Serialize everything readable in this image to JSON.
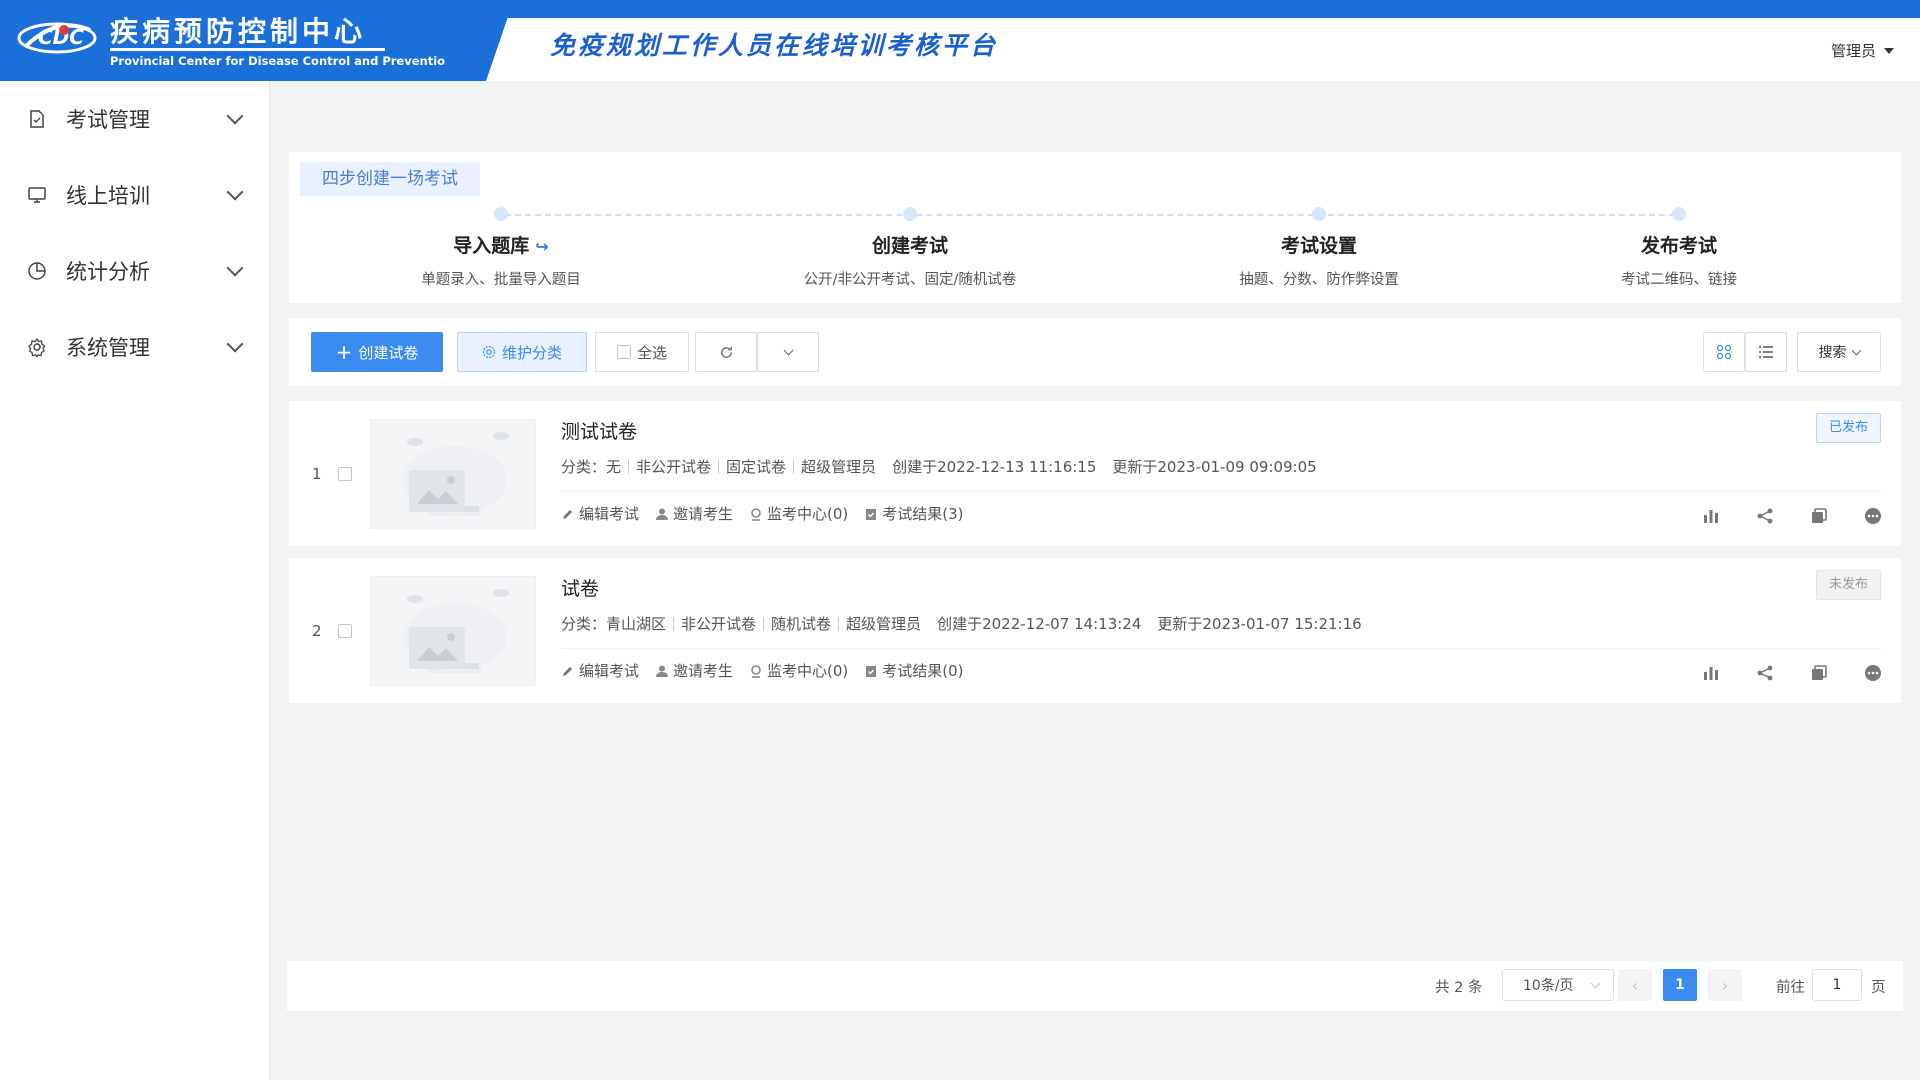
{
  "header": {
    "logo_cn": "疾病预防控制中心",
    "logo_en": "Provincial Center for Disease Control and Preventio",
    "platform_title": "免疫规划工作人员在线培训考核平台",
    "user": "管理员"
  },
  "sidebar": {
    "items": [
      {
        "label": "考试管理",
        "icon": "exam-doc-icon"
      },
      {
        "label": "线上培训",
        "icon": "monitor-icon"
      },
      {
        "label": "统计分析",
        "icon": "pie-chart-icon"
      },
      {
        "label": "系统管理",
        "icon": "gear-icon"
      }
    ]
  },
  "steps": {
    "tag": "四步创建一场考试",
    "items": [
      {
        "title": "导入题库",
        "desc": "单题录入、批量导入题目"
      },
      {
        "title": "创建考试",
        "desc": "公开/非公开考试、固定/随机试卷"
      },
      {
        "title": "考试设置",
        "desc": "抽题、分数、防作弊设置"
      },
      {
        "title": "发布考试",
        "desc": "考试二维码、链接"
      }
    ]
  },
  "toolbar": {
    "create": "创建试卷",
    "category": "维护分类",
    "select_all": "全选",
    "search": "搜索"
  },
  "exams": [
    {
      "index": "1",
      "title": "测试试卷",
      "category": "分类：无",
      "visibility": "非公开试卷",
      "paper_type": "固定试卷",
      "owner": "超级管理员",
      "created": "创建于2022-12-13 11:16:15",
      "updated": "更新于2023-01-09 09:09:05",
      "status": "已发布",
      "actions": {
        "edit": "编辑考试",
        "invite": "邀请考生",
        "monitor": "监考中心(0)",
        "results": "考试结果(3)"
      }
    },
    {
      "index": "2",
      "title": "试卷",
      "category": "分类：青山湖区",
      "visibility": "非公开试卷",
      "paper_type": "随机试卷",
      "owner": "超级管理员",
      "created": "创建于2022-12-07 14:13:24",
      "updated": "更新于2023-01-07 15:21:16",
      "status": "未发布",
      "actions": {
        "edit": "编辑考试",
        "invite": "邀请考生",
        "monitor": "监考中心(0)",
        "results": "考试结果(0)"
      }
    }
  ],
  "pagination": {
    "total": "共 2 条",
    "page_size": "10条/页",
    "current_page": "1",
    "goto_label": "前往",
    "goto_value": "1",
    "page_unit": "页"
  },
  "colors": {
    "brand_blue": "#1a6fd8",
    "primary": "#3b8cf0"
  }
}
